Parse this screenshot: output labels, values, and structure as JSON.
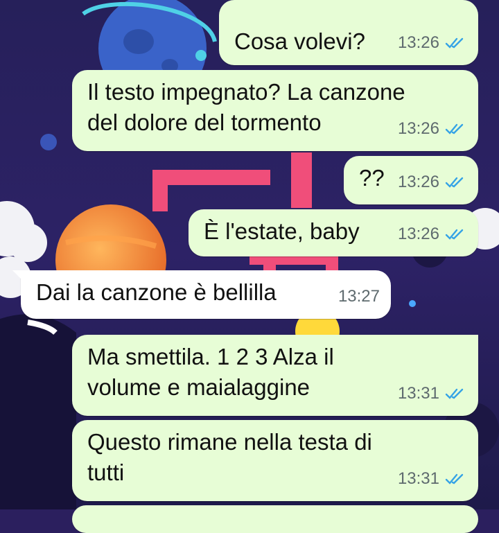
{
  "colors": {
    "outgoing_bubble": "#e7fdd6",
    "incoming_bubble": "#ffffff",
    "read_check": "#35a3e6",
    "time": "#5e6a6e"
  },
  "status_icon": "double-check-read-icon",
  "messages": [
    {
      "direction": "out",
      "text": "Cosa volevi?",
      "time": "13:26",
      "status": "read"
    },
    {
      "direction": "out",
      "text": "Il testo impegnato? La canzone\ndel dolore del tormento",
      "time": "13:26",
      "status": "read"
    },
    {
      "direction": "out",
      "text": "??",
      "time": "13:26",
      "status": "read"
    },
    {
      "direction": "out",
      "text": "È l'estate, baby",
      "time": "13:26",
      "status": "read"
    },
    {
      "direction": "in",
      "text": "Dai la canzone è bellilla",
      "time": "13:27"
    },
    {
      "direction": "out",
      "text": "Ma smettila. 1 2 3 Alza il\nvolume e maialaggine",
      "time": "13:31",
      "status": "read"
    },
    {
      "direction": "out",
      "text": "Questo rimane nella testa di\ntutti",
      "time": "13:31",
      "status": "read"
    }
  ]
}
